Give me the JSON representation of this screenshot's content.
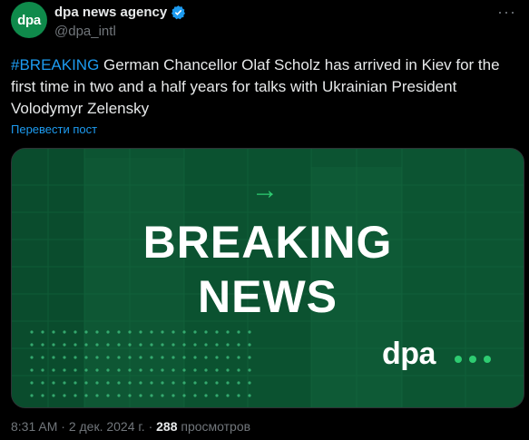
{
  "author": {
    "avatar_text": "dpa",
    "display_name": "dpa news agency",
    "handle": "@dpa_intl",
    "verified": true
  },
  "tweet": {
    "hashtag": "#BREAKING",
    "text": " German Chancellor Olaf Scholz has arrived in Kiev for the first time in two and a half years for talks with Ukrainian President Volodymyr Zelensky",
    "translate_label": "Перевести пост"
  },
  "media": {
    "headline_line1": "BREAKING",
    "headline_line2": "NEWS",
    "logo_text": "dpa",
    "arrow_icon": "arrow-right-icon"
  },
  "meta": {
    "time": "8:31 AM",
    "date": "2 дек. 2024 г.",
    "views_count": "288",
    "views_label": "просмотров"
  },
  "colors": {
    "accent": "#1d9bf0",
    "brand_green": "#0f8a4b",
    "highlight_green": "#2ecc71"
  }
}
